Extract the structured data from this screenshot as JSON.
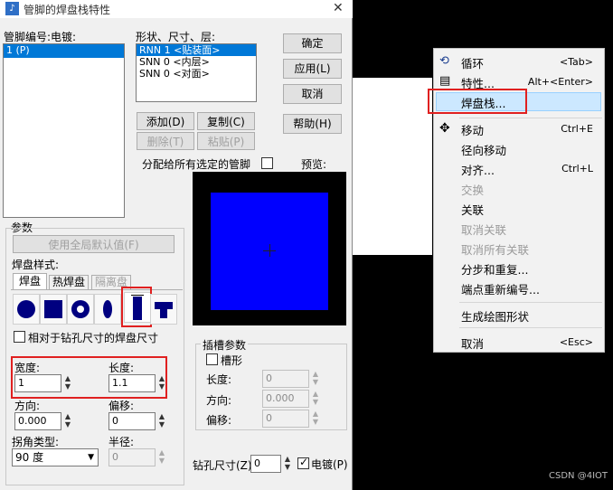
{
  "dialog": {
    "title": "管脚的焊盘栈特性",
    "pin_label": "管脚编号:电镀:",
    "pin_items": [
      "1 (P)"
    ],
    "layer_label": "形状、尺寸、层:",
    "layer_items": [
      "RNN 1 <贴装面>",
      "SNN 0 <内层>",
      "SNN 0 <对面>"
    ],
    "buttons": {
      "ok": "确定",
      "apply": "应用(L)",
      "cancel": "取消",
      "help": "帮助(H)",
      "add": "添加(D)",
      "copy": "复制(C)",
      "delete": "删除(T)",
      "paste": "粘贴(P)"
    },
    "assign_label": "分配给所有选定的管脚",
    "preview_label": "预览:",
    "params_label": "参数",
    "global_default_label": "使用全局默认值(F)",
    "pad_style_label": "焊盘样式:",
    "tabs": [
      "焊盘",
      "热焊盘",
      "隔离盘"
    ],
    "relative_label": "相对于钻孔尺寸的焊盘尺寸",
    "width_label": "宽度:",
    "width_value": "1",
    "length_label": "长度:",
    "length_value": "1.1",
    "direction_label": "方向:",
    "direction_value": "0.000",
    "offset_label": "偏移:",
    "offset_value": "0",
    "corner_label": "拐角类型:",
    "corner_value": "90 度",
    "radius_label": "半径:",
    "radius_value": "0",
    "slot_group_label": "插槽参数",
    "slot_label": "槽形",
    "slot_length_label": "长度:",
    "slot_length_value": "0",
    "slot_direction_label": "方向:",
    "slot_direction_value": "0.000",
    "slot_offset_label": "偏移:",
    "slot_offset_value": "0",
    "drill_label": "钻孔尺寸(Z):",
    "drill_value": "0",
    "plated_label": "电镀(P)"
  },
  "menu": {
    "items": [
      {
        "label": "循环",
        "shortcut": "<Tab>"
      },
      {
        "label": "特性...",
        "shortcut": "Alt+<Enter>"
      },
      {
        "label": "焊盘栈...",
        "shortcut": ""
      },
      {
        "label": "移动",
        "shortcut": "Ctrl+E"
      },
      {
        "label": "径向移动",
        "shortcut": ""
      },
      {
        "label": "对齐...",
        "shortcut": "Ctrl+L"
      },
      {
        "label": "交换",
        "shortcut": ""
      },
      {
        "label": "关联",
        "shortcut": ""
      },
      {
        "label": "取消关联",
        "shortcut": ""
      },
      {
        "label": "取消所有关联",
        "shortcut": ""
      },
      {
        "label": "分步和重复...",
        "shortcut": ""
      },
      {
        "label": "端点重新编号...",
        "shortcut": ""
      },
      {
        "label": "生成绘图形状",
        "shortcut": ""
      },
      {
        "label": "取消",
        "shortcut": "<Esc>"
      }
    ]
  },
  "watermark": "CSDN @4IOT",
  "colors": {
    "pad": "#0000ff",
    "highlight": "#e02020",
    "selection": "#0078d7"
  }
}
